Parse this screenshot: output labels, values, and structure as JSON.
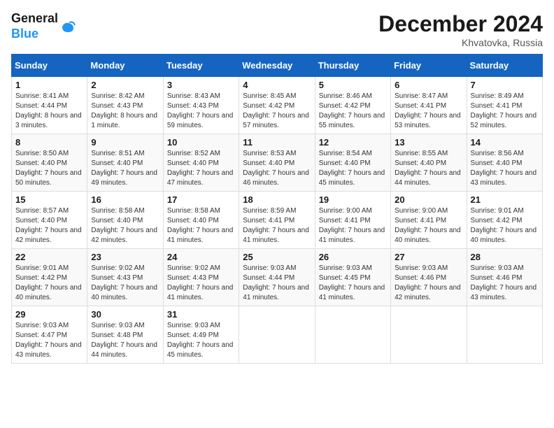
{
  "header": {
    "logo_line1": "General",
    "logo_line2": "Blue",
    "month_title": "December 2024",
    "location": "Khvatovka, Russia"
  },
  "days_of_week": [
    "Sunday",
    "Monday",
    "Tuesday",
    "Wednesday",
    "Thursday",
    "Friday",
    "Saturday"
  ],
  "weeks": [
    [
      {
        "day": "1",
        "sunrise": "8:41 AM",
        "sunset": "4:44 PM",
        "daylight": "8 hours and 3 minutes."
      },
      {
        "day": "2",
        "sunrise": "8:42 AM",
        "sunset": "4:43 PM",
        "daylight": "8 hours and 1 minute."
      },
      {
        "day": "3",
        "sunrise": "8:43 AM",
        "sunset": "4:43 PM",
        "daylight": "7 hours and 59 minutes."
      },
      {
        "day": "4",
        "sunrise": "8:45 AM",
        "sunset": "4:42 PM",
        "daylight": "7 hours and 57 minutes."
      },
      {
        "day": "5",
        "sunrise": "8:46 AM",
        "sunset": "4:42 PM",
        "daylight": "7 hours and 55 minutes."
      },
      {
        "day": "6",
        "sunrise": "8:47 AM",
        "sunset": "4:41 PM",
        "daylight": "7 hours and 53 minutes."
      },
      {
        "day": "7",
        "sunrise": "8:49 AM",
        "sunset": "4:41 PM",
        "daylight": "7 hours and 52 minutes."
      }
    ],
    [
      {
        "day": "8",
        "sunrise": "8:50 AM",
        "sunset": "4:40 PM",
        "daylight": "7 hours and 50 minutes."
      },
      {
        "day": "9",
        "sunrise": "8:51 AM",
        "sunset": "4:40 PM",
        "daylight": "7 hours and 49 minutes."
      },
      {
        "day": "10",
        "sunrise": "8:52 AM",
        "sunset": "4:40 PM",
        "daylight": "7 hours and 47 minutes."
      },
      {
        "day": "11",
        "sunrise": "8:53 AM",
        "sunset": "4:40 PM",
        "daylight": "7 hours and 46 minutes."
      },
      {
        "day": "12",
        "sunrise": "8:54 AM",
        "sunset": "4:40 PM",
        "daylight": "7 hours and 45 minutes."
      },
      {
        "day": "13",
        "sunrise": "8:55 AM",
        "sunset": "4:40 PM",
        "daylight": "7 hours and 44 minutes."
      },
      {
        "day": "14",
        "sunrise": "8:56 AM",
        "sunset": "4:40 PM",
        "daylight": "7 hours and 43 minutes."
      }
    ],
    [
      {
        "day": "15",
        "sunrise": "8:57 AM",
        "sunset": "4:40 PM",
        "daylight": "7 hours and 42 minutes."
      },
      {
        "day": "16",
        "sunrise": "8:58 AM",
        "sunset": "4:40 PM",
        "daylight": "7 hours and 42 minutes."
      },
      {
        "day": "17",
        "sunrise": "8:58 AM",
        "sunset": "4:40 PM",
        "daylight": "7 hours and 41 minutes."
      },
      {
        "day": "18",
        "sunrise": "8:59 AM",
        "sunset": "4:41 PM",
        "daylight": "7 hours and 41 minutes."
      },
      {
        "day": "19",
        "sunrise": "9:00 AM",
        "sunset": "4:41 PM",
        "daylight": "7 hours and 41 minutes."
      },
      {
        "day": "20",
        "sunrise": "9:00 AM",
        "sunset": "4:41 PM",
        "daylight": "7 hours and 40 minutes."
      },
      {
        "day": "21",
        "sunrise": "9:01 AM",
        "sunset": "4:42 PM",
        "daylight": "7 hours and 40 minutes."
      }
    ],
    [
      {
        "day": "22",
        "sunrise": "9:01 AM",
        "sunset": "4:42 PM",
        "daylight": "7 hours and 40 minutes."
      },
      {
        "day": "23",
        "sunrise": "9:02 AM",
        "sunset": "4:43 PM",
        "daylight": "7 hours and 40 minutes."
      },
      {
        "day": "24",
        "sunrise": "9:02 AM",
        "sunset": "4:43 PM",
        "daylight": "7 hours and 41 minutes."
      },
      {
        "day": "25",
        "sunrise": "9:03 AM",
        "sunset": "4:44 PM",
        "daylight": "7 hours and 41 minutes."
      },
      {
        "day": "26",
        "sunrise": "9:03 AM",
        "sunset": "4:45 PM",
        "daylight": "7 hours and 41 minutes."
      },
      {
        "day": "27",
        "sunrise": "9:03 AM",
        "sunset": "4:46 PM",
        "daylight": "7 hours and 42 minutes."
      },
      {
        "day": "28",
        "sunrise": "9:03 AM",
        "sunset": "4:46 PM",
        "daylight": "7 hours and 43 minutes."
      }
    ],
    [
      {
        "day": "29",
        "sunrise": "9:03 AM",
        "sunset": "4:47 PM",
        "daylight": "7 hours and 43 minutes."
      },
      {
        "day": "30",
        "sunrise": "9:03 AM",
        "sunset": "4:48 PM",
        "daylight": "7 hours and 44 minutes."
      },
      {
        "day": "31",
        "sunrise": "9:03 AM",
        "sunset": "4:49 PM",
        "daylight": "7 hours and 45 minutes."
      },
      null,
      null,
      null,
      null
    ]
  ],
  "labels": {
    "sunrise": "Sunrise:",
    "sunset": "Sunset:",
    "daylight": "Daylight:"
  }
}
